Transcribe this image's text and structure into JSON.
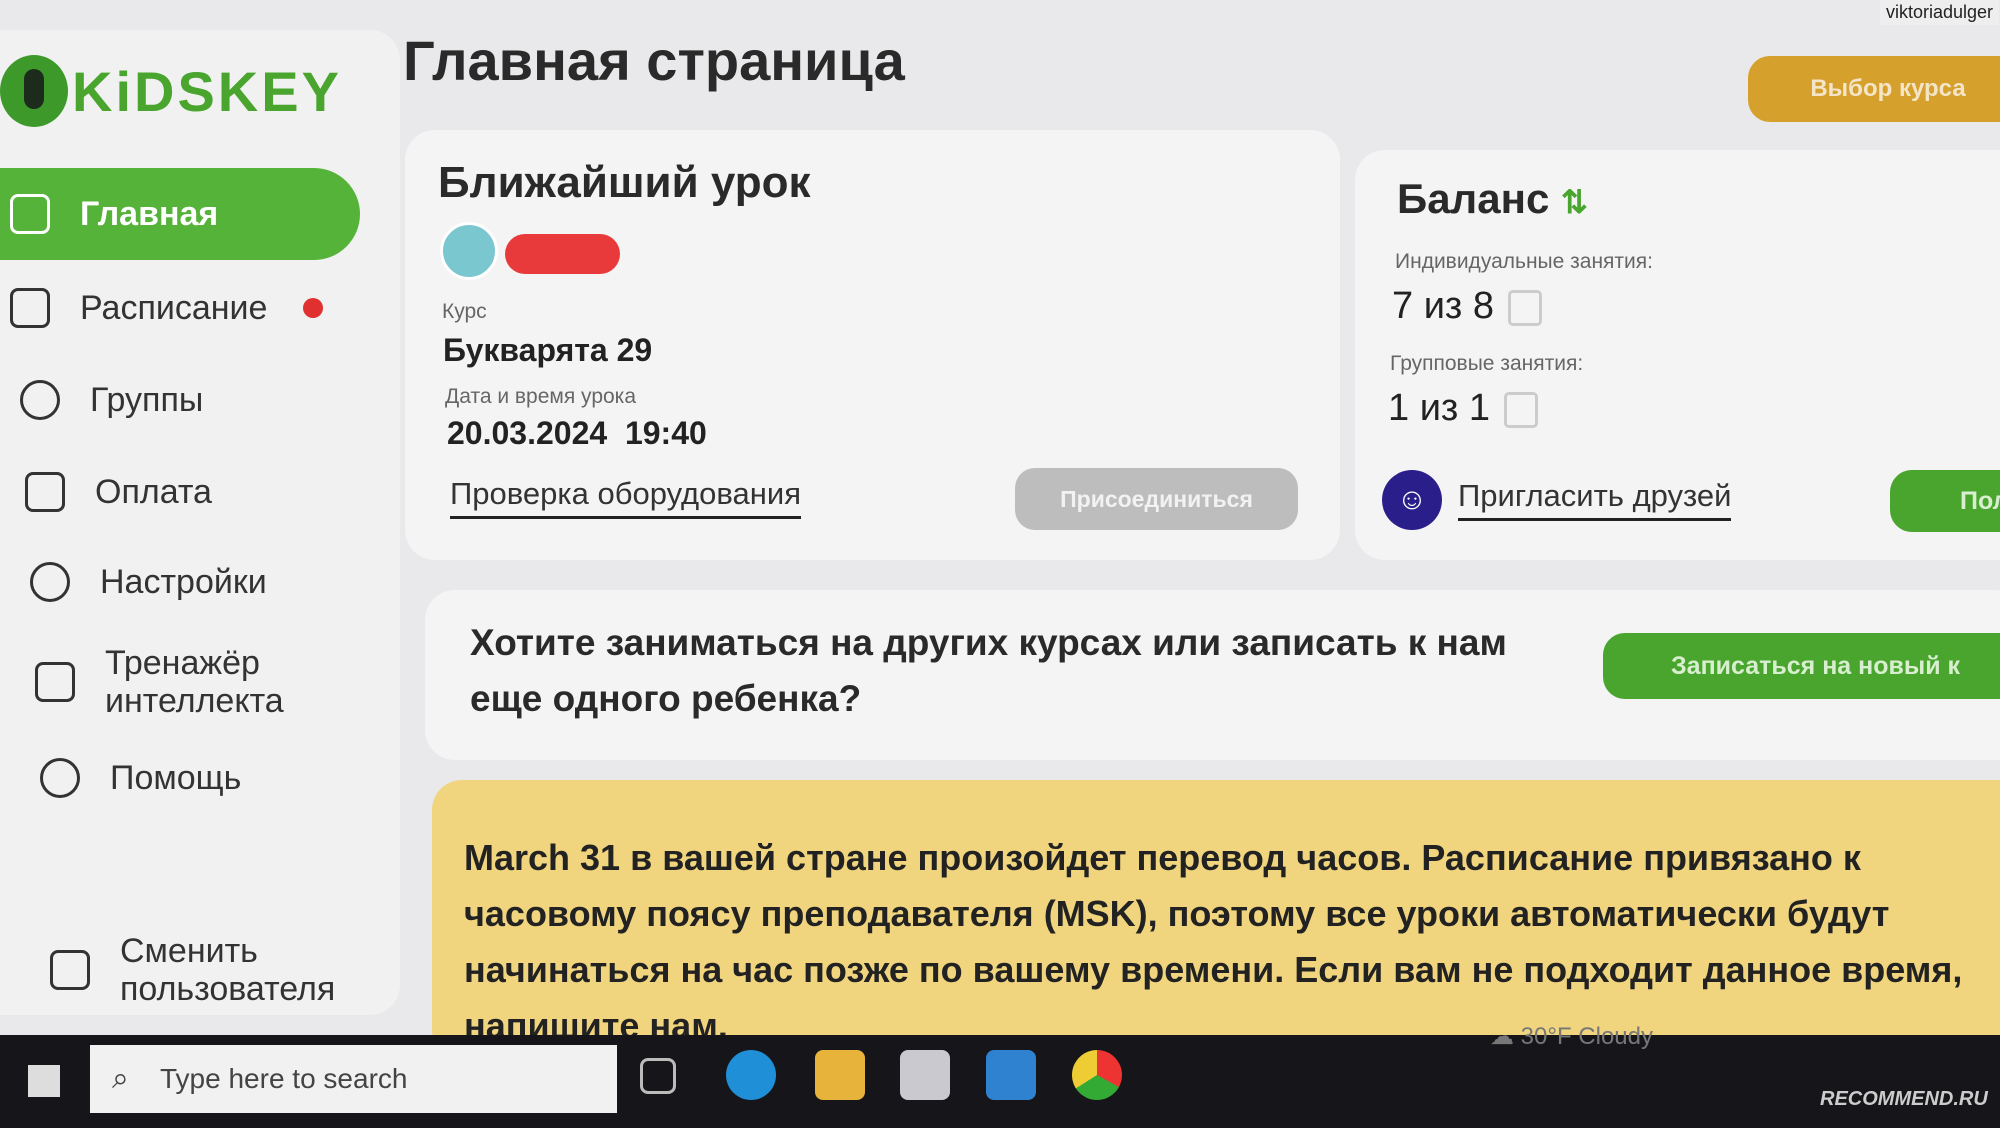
{
  "watermark": "viktoriadulger",
  "logo": "KiDSKEY",
  "sidebar": {
    "items": [
      {
        "label": "Главная",
        "icon": "home-icon",
        "active": true
      },
      {
        "label": "Расписание",
        "icon": "calendar-icon",
        "badge": true
      },
      {
        "label": "Группы",
        "icon": "users-icon"
      },
      {
        "label": "Оплата",
        "icon": "wallet-icon"
      },
      {
        "label": "Настройки",
        "icon": "gear-icon"
      },
      {
        "label": "Тренажёр интеллекта",
        "icon": "puzzle-icon"
      },
      {
        "label": "Помощь",
        "icon": "help-icon"
      },
      {
        "label": "Сменить пользователя",
        "icon": "logout-icon"
      }
    ]
  },
  "header": {
    "title": "Главная страница",
    "course_button": "Выбор курса"
  },
  "lesson": {
    "title": "Ближайший урок",
    "course_label": "Курс",
    "course": "Букварята 29",
    "datetime_label": "Дата и время урока",
    "date": "20.03.2024",
    "time": "19:40",
    "check": "Проверка оборудования",
    "join": "Присоединиться"
  },
  "balance": {
    "title": "Баланс",
    "individual_label": "Индивидуальные занятия:",
    "individual": "7 из 8",
    "group_label": "Групповые занятия:",
    "group": "1 из 1",
    "invite": "Пригласить друзей",
    "topup": "Пол"
  },
  "promo": {
    "text": "Хотите заниматься на других курсах или записать к нам еще одного ребенка?",
    "button": "Записаться на новый к"
  },
  "notice": {
    "text": "March 31 в вашей стране произойдет перевод часов. Расписание привязано к часовому поясу преподавателя (MSK), поэтому все уроки автоматически будут начинаться на час позже по вашему времени. Если вам не подходит данное время, напишите нам.",
    "color": "#f0d57e"
  },
  "taskbar": {
    "search_placeholder": "Type here to search",
    "weather": "30°F  Cloudy"
  },
  "colors": {
    "accent": "#55b33a",
    "orange": "#d6a02c"
  },
  "recommend": "RECOMMEND.RU"
}
